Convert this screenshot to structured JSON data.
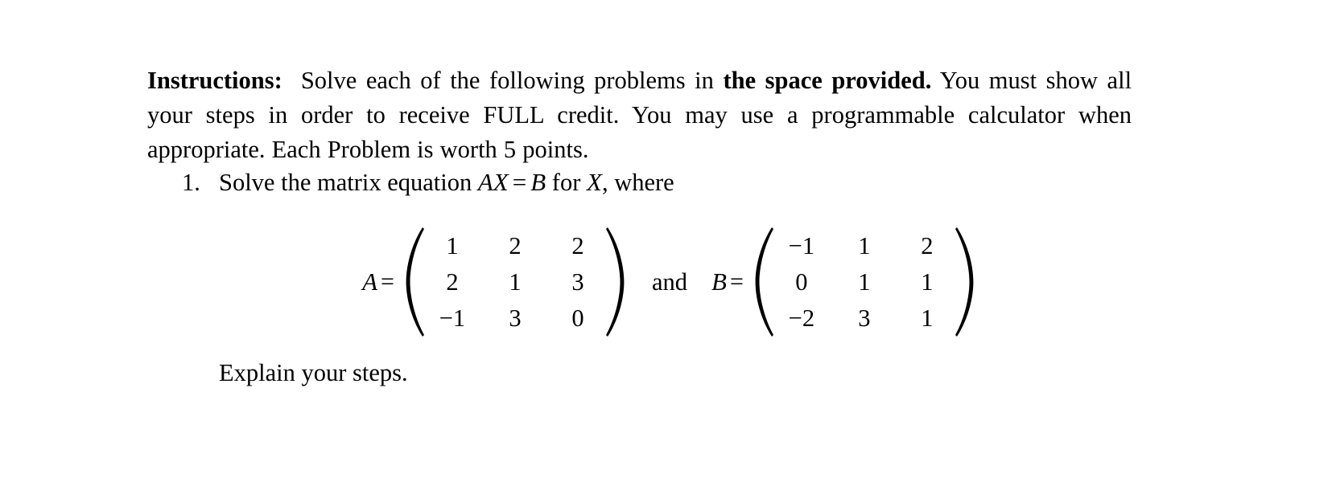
{
  "document": {
    "background_color": "#ffffff",
    "text_color": "#000000"
  },
  "instructions": {
    "label": "Instructions:",
    "text_part_1": "Solve each of the following problems in",
    "bold_phrase": "the space provided.",
    "text_part_2": "You must show all your steps in order to receive FULL credit. You may use a programmable calculator when appropriate. Each Problem is worth 5 points."
  },
  "problem": {
    "number": "1.",
    "prompt_before": "Solve the matrix equation",
    "equation_lhs": "AX",
    "equation_op": "=",
    "equation_rhs": "B",
    "prompt_mid": "for",
    "unknown": "X",
    "prompt_after": ", where",
    "explain": "Explain your steps."
  },
  "matrices": {
    "conjunction": "and",
    "equals": "=",
    "A": {
      "label": "A",
      "rows": [
        [
          "1",
          "2",
          "2"
        ],
        [
          "2",
          "1",
          "3"
        ],
        [
          "−1",
          "3",
          "0"
        ]
      ]
    },
    "B": {
      "label": "B",
      "rows": [
        [
          "−1",
          "1",
          "2"
        ],
        [
          "0",
          "1",
          "1"
        ],
        [
          "−2",
          "3",
          "1"
        ]
      ]
    }
  }
}
